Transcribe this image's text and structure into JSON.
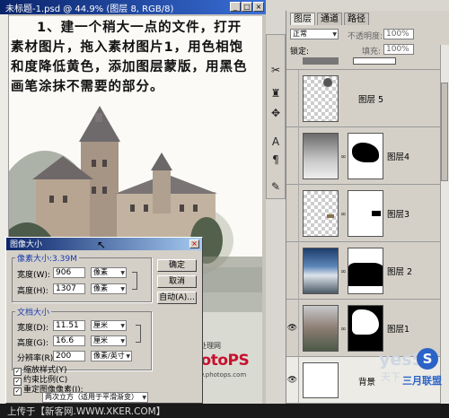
{
  "document": {
    "title": "未标题-1.psd @ 44.9% (图层 8, RGB/8)",
    "instruction": "1、建一个稍大一点的文件，打开素材图片，拖入素材图片1，用色相饱和度降低黄色，添加图层蒙版，用黑色画笔涂抹不需要的部分。",
    "logo_caption": "照片处理网",
    "logo_text": "PhotoPS",
    "logo_url": "www.photops.com"
  },
  "bottom_bar": {
    "text": "上传于【新客网.WWW.XKER.COM】"
  },
  "image_size_dialog": {
    "title": "图像大小",
    "close": "×",
    "pixel_group": {
      "label": "像素大小:3.39M",
      "width_label": "宽度(W):",
      "width_value": "906",
      "height_label": "高度(H):",
      "height_value": "1307",
      "unit": "像素"
    },
    "doc_group": {
      "label": "文档大小",
      "width_label": "宽度(D):",
      "width_value": "11.51",
      "height_label": "高度(G):",
      "height_value": "16.6",
      "unit": "厘米",
      "res_label": "分辨率(R):",
      "res_value": "200",
      "res_unit": "像素/英寸"
    },
    "ok_label": "确定",
    "cancel_label": "取消",
    "auto_label": "自动(A)...",
    "check_scale_styles": "缩放样式(Y)",
    "check_constrain": "约束比例(C)",
    "check_resample": "重定图像像素(I):",
    "resample_method": "两次立方（适用于平滑渐变）"
  },
  "tools": {
    "icons": [
      "scissors-icon",
      "stamp-icon",
      "move-icon",
      "type-icon",
      "paragraph-icon",
      "brush-icon"
    ],
    "glyphs": [
      "✂",
      "♜",
      "✥",
      "A",
      "¶",
      "✎"
    ]
  },
  "layers_panel": {
    "tabs": [
      "图层",
      "通道",
      "路径"
    ],
    "blend_mode": "正常",
    "opacity_label": "不透明度:",
    "opacity_value": "100%",
    "lock_label": "锁定:",
    "fill_label": "填充:",
    "fill_value": "100%",
    "layers": [
      {
        "name": "图层 5",
        "visible": false
      },
      {
        "name": "图层4",
        "visible": false
      },
      {
        "name": "图层3",
        "visible": false
      },
      {
        "name": "图层 2",
        "visible": false
      },
      {
        "name": "图层1",
        "visible": true
      },
      {
        "name": "背景",
        "visible": true
      }
    ]
  },
  "watermark": {
    "text": "yes5",
    "sub": "天下",
    "badge": "S",
    "side": "三月联盟"
  }
}
